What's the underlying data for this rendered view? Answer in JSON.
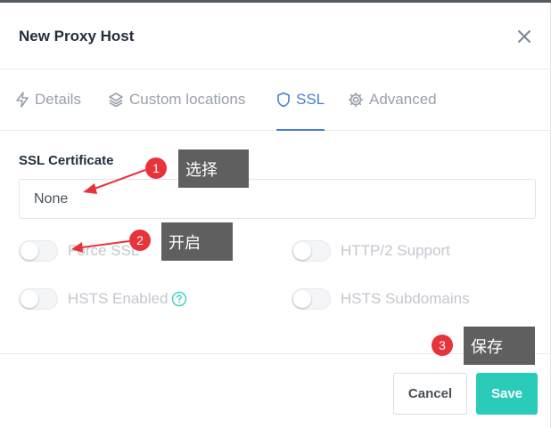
{
  "dialog": {
    "title": "New Proxy Host"
  },
  "tabs": [
    {
      "label": "Details",
      "icon": "lightning-icon"
    },
    {
      "label": "Custom locations",
      "icon": "layers-icon"
    },
    {
      "label": "SSL",
      "icon": "shield-icon",
      "active": true
    },
    {
      "label": "Advanced",
      "icon": "gear-icon"
    }
  ],
  "ssl": {
    "certificate_label": "SSL Certificate",
    "certificate_value": "None",
    "switches": {
      "force_ssl": "Force SSL",
      "http2": "HTTP/2 Support",
      "hsts": "HSTS Enabled",
      "hsts_subdomains": "HSTS Subdomains"
    }
  },
  "footer": {
    "cancel_label": "Cancel",
    "save_label": "Save"
  },
  "annotations": [
    {
      "number": "1",
      "text": "选择"
    },
    {
      "number": "2",
      "text": "开启"
    },
    {
      "number": "3",
      "text": "保存"
    }
  ],
  "colors": {
    "accent": "#467fcf",
    "save": "#2bcbba",
    "annotation_red": "#e8333a",
    "annotation_box": "#5f5f5f"
  }
}
